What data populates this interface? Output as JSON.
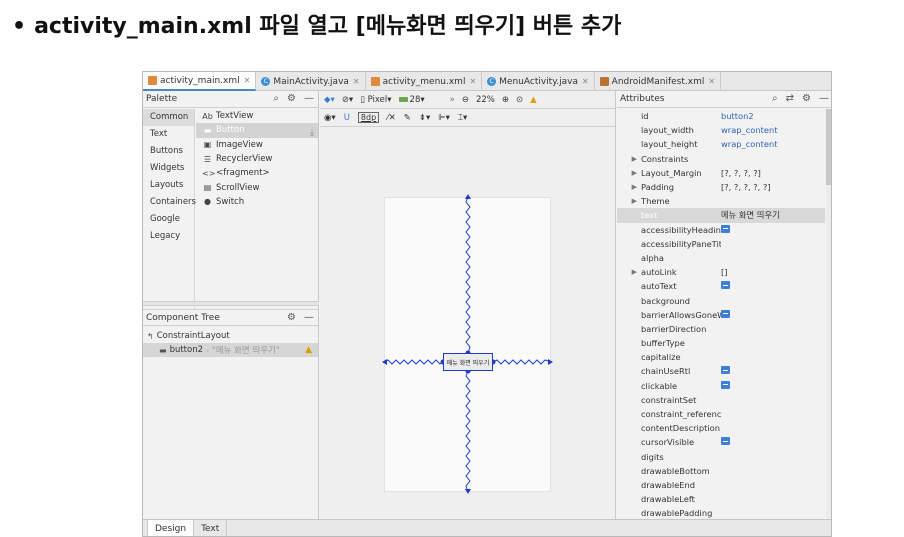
{
  "slide": {
    "bullet": "•",
    "title": "activity_main.xml 파일 열고 [메뉴화면 띄우기] 버튼 추가"
  },
  "tabs": [
    {
      "label": "activity_main.xml",
      "icon": "xml-file-icon",
      "active": true
    },
    {
      "label": "MainActivity.java",
      "icon": "java-class-icon",
      "active": false
    },
    {
      "label": "activity_menu.xml",
      "icon": "xml-file-icon",
      "active": false
    },
    {
      "label": "MenuActivity.java",
      "icon": "java-class-icon",
      "active": false
    },
    {
      "label": "AndroidManifest.xml",
      "icon": "manifest-file-icon",
      "active": false
    }
  ],
  "palette": {
    "title": "Palette",
    "categories": [
      "Common",
      "Text",
      "Buttons",
      "Widgets",
      "Layouts",
      "Containers",
      "Google",
      "Legacy"
    ],
    "widgets": [
      {
        "icon": "Ab",
        "label": "TextView"
      },
      {
        "icon": "▬",
        "label": "Button"
      },
      {
        "icon": "▣",
        "label": "ImageView"
      },
      {
        "icon": "☰",
        "label": "RecyclerView"
      },
      {
        "icon": "<>",
        "label": "<fragment>"
      },
      {
        "icon": "▤",
        "label": "ScrollView"
      },
      {
        "icon": "●",
        "label": "Switch"
      }
    ]
  },
  "component_tree": {
    "title": "Component Tree",
    "root": "ConstraintLayout",
    "child": "button2",
    "child_hint": "- \"메뉴 화면 띄우기\""
  },
  "design_toolbar": {
    "device": "Pixel",
    "api": "28",
    "zoom": "22%",
    "margin": "8dp"
  },
  "design": {
    "button_text": "메뉴 화면 띄우기"
  },
  "attributes": {
    "title": "Attributes",
    "rows": [
      {
        "name": "id",
        "value": "button2",
        "arrow": "",
        "blue": true
      },
      {
        "name": "layout_width",
        "value": "wrap_content",
        "arrow": "",
        "blue": true
      },
      {
        "name": "layout_height",
        "value": "wrap_content",
        "arrow": "",
        "blue": true
      },
      {
        "name": "Constraints",
        "value": "",
        "arrow": "▶",
        "blue": false
      },
      {
        "name": "Layout_Margin",
        "value": "[?, ?, ?, ?]",
        "arrow": "▶",
        "blue": false
      },
      {
        "name": "Padding",
        "value": "[?, ?, ?, ?, ?]",
        "arrow": "▶",
        "blue": false
      },
      {
        "name": "Theme",
        "value": "",
        "arrow": "▶",
        "blue": false
      },
      {
        "name": "text",
        "value": "메뉴 화면 띄우기",
        "arrow": "",
        "blue": false,
        "selected": true
      },
      {
        "name": "accessibilityHeading",
        "value": "",
        "arrow": "",
        "bool": true
      },
      {
        "name": "accessibilityPaneTitle",
        "value": "",
        "arrow": ""
      },
      {
        "name": "alpha",
        "value": "",
        "arrow": ""
      },
      {
        "name": "autoLink",
        "value": "[]",
        "arrow": "▶",
        "blue": false
      },
      {
        "name": "autoText",
        "value": "",
        "arrow": "",
        "bool": true
      },
      {
        "name": "background",
        "value": "",
        "arrow": ""
      },
      {
        "name": "barrierAllowsGoneWidgets",
        "value": "",
        "arrow": "",
        "bool": true
      },
      {
        "name": "barrierDirection",
        "value": "",
        "arrow": ""
      },
      {
        "name": "bufferType",
        "value": "",
        "arrow": ""
      },
      {
        "name": "capitalize",
        "value": "",
        "arrow": ""
      },
      {
        "name": "chainUseRtl",
        "value": "",
        "arrow": "",
        "bool": true
      },
      {
        "name": "clickable",
        "value": "",
        "arrow": "",
        "bool": true
      },
      {
        "name": "constraintSet",
        "value": "",
        "arrow": ""
      },
      {
        "name": "constraint_referenced_ids",
        "value": "",
        "arrow": ""
      },
      {
        "name": "contentDescription",
        "value": "",
        "arrow": ""
      },
      {
        "name": "cursorVisible",
        "value": "",
        "arrow": "",
        "bool": true
      },
      {
        "name": "digits",
        "value": "",
        "arrow": ""
      },
      {
        "name": "drawableBottom",
        "value": "",
        "arrow": ""
      },
      {
        "name": "drawableEnd",
        "value": "",
        "arrow": ""
      },
      {
        "name": "drawableLeft",
        "value": "",
        "arrow": ""
      },
      {
        "name": "drawablePadding",
        "value": "",
        "arrow": ""
      }
    ]
  },
  "bottom_tabs": [
    "Design",
    "Text"
  ]
}
